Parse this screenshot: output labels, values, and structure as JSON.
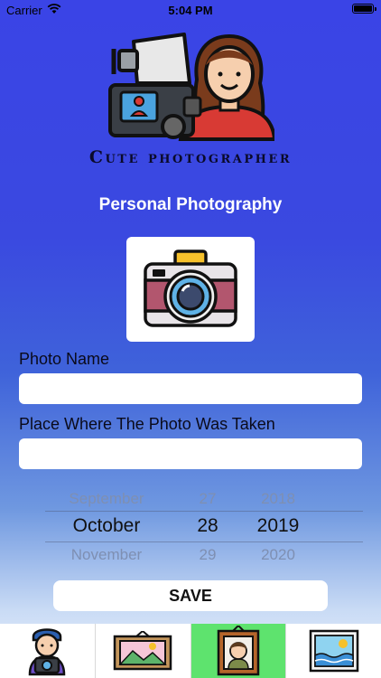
{
  "status_bar": {
    "carrier": "Carrier",
    "time": "5:04 PM"
  },
  "header": {
    "logo_icon": "photographer-with-camera-icon",
    "brand": "Cute photographer",
    "subtitle": "Personal Photography"
  },
  "photo": {
    "icon": "camera-icon"
  },
  "form": {
    "photo_name_label": "Photo Name",
    "photo_name_value": "",
    "place_label": "Place Where The Photo Was Taken",
    "place_value": ""
  },
  "date_picker": {
    "above": {
      "month": "September",
      "day": "27",
      "year": "2018"
    },
    "selected": {
      "month": "October",
      "day": "28",
      "year": "2019"
    },
    "below": {
      "month": "November",
      "day": "29",
      "year": "2020"
    }
  },
  "save_label": "SAVE",
  "tabs": [
    {
      "icon": "photographer-icon",
      "active": false
    },
    {
      "icon": "landscape-frame-icon",
      "active": false
    },
    {
      "icon": "portrait-frame-icon",
      "active": true
    },
    {
      "icon": "seascape-picture-icon",
      "active": false
    }
  ],
  "colors": {
    "accent_tab": "#5ee36e",
    "gradient_top": "#3a44e6",
    "gradient_bottom": "#eef3fb"
  }
}
